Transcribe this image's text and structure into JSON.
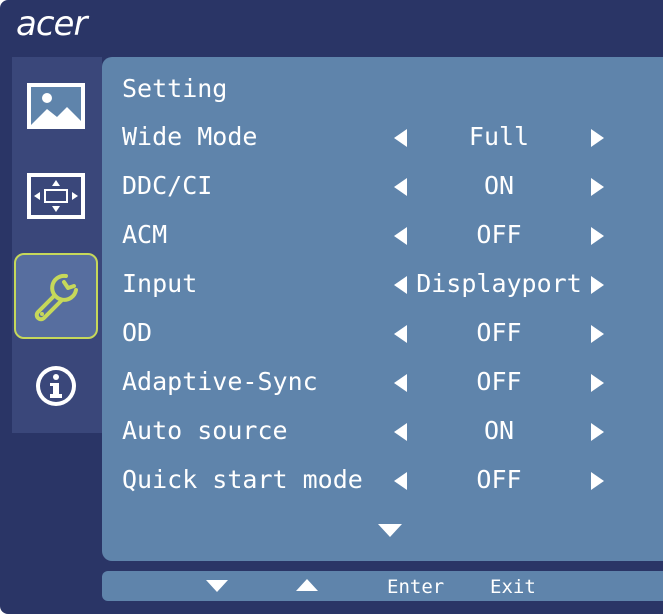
{
  "brand": "acer",
  "colors": {
    "frame": "#2a3566",
    "nav_bg": "#3a477a",
    "panel": "#5f84ab",
    "active_border": "#c6d85a",
    "text": "#ffffff"
  },
  "nav": {
    "items": [
      {
        "icon": "picture-icon",
        "active": false
      },
      {
        "icon": "screen-position-icon",
        "active": false
      },
      {
        "icon": "wrench-settings-icon",
        "active": true
      },
      {
        "icon": "info-icon",
        "active": false
      }
    ]
  },
  "menu": {
    "title": "Setting",
    "rows": [
      {
        "label": "Wide Mode",
        "value": "Full"
      },
      {
        "label": "DDC/CI",
        "value": "ON"
      },
      {
        "label": "ACM",
        "value": "OFF"
      },
      {
        "label": "Input",
        "value": "Displayport"
      },
      {
        "label": "OD",
        "value": "OFF"
      },
      {
        "label": "Adaptive-Sync",
        "value": "OFF"
      },
      {
        "label": "Auto source",
        "value": "ON"
      },
      {
        "label": "Quick start mode",
        "value": "OFF"
      }
    ],
    "more_indicator": "chevron-down-icon"
  },
  "footer": {
    "down_icon": "arrow-down-icon",
    "up_icon": "arrow-up-icon",
    "enter_label": "Enter",
    "exit_label": "Exit"
  }
}
